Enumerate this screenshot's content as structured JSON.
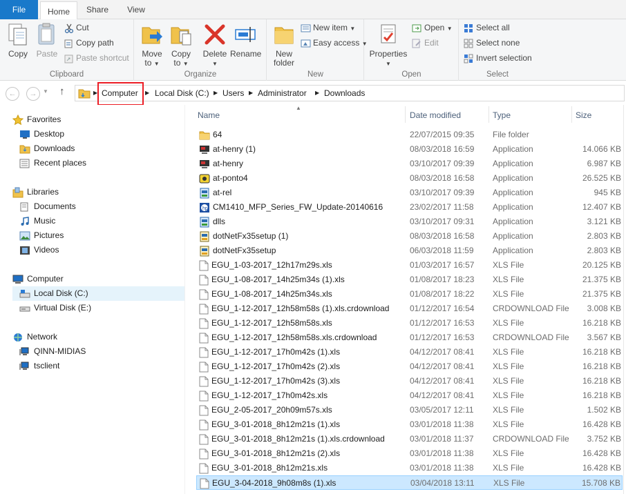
{
  "tabs": [
    {
      "label": "File"
    },
    {
      "label": "Home"
    },
    {
      "label": "Share"
    },
    {
      "label": "View"
    }
  ],
  "ribbon": {
    "clipboard": {
      "label": "Clipboard",
      "copy": "Copy",
      "paste": "Paste",
      "cut": "Cut",
      "copy_path": "Copy path",
      "paste_shortcut": "Paste shortcut"
    },
    "organize": {
      "label": "Organize",
      "move_to": "Move",
      "move_to2": "to",
      "copy_to": "Copy",
      "copy_to2": "to",
      "delete": "Delete",
      "rename": "Rename"
    },
    "new": {
      "label": "New",
      "new_folder": "New",
      "new_folder2": "folder",
      "new_item": "New item",
      "easy_access": "Easy access"
    },
    "open": {
      "label": "Open",
      "properties": "Properties",
      "open": "Open",
      "edit": "Edit"
    },
    "select": {
      "label": "Select",
      "select_all": "Select all",
      "select_none": "Select none",
      "invert": "Invert selection"
    }
  },
  "address": {
    "crumbs": [
      "Computer",
      "Local Disk (C:)",
      "Users",
      "Administrator",
      "Downloads"
    ]
  },
  "nav": {
    "favorites": "Favorites",
    "desktop": "Desktop",
    "downloads": "Downloads",
    "recent": "Recent places",
    "libraries": "Libraries",
    "documents": "Documents",
    "music": "Music",
    "pictures": "Pictures",
    "videos": "Videos",
    "computer": "Computer",
    "local_disk": "Local Disk (C:)",
    "virtual_disk": "Virtual Disk (E:)",
    "network": "Network",
    "qinn": "QINN-MIDIAS",
    "tsclient": "tsclient"
  },
  "columns": {
    "name": "Name",
    "date": "Date modified",
    "type": "Type",
    "size": "Size"
  },
  "files": [
    {
      "name": "64",
      "date": "22/07/2015 09:35",
      "type": "File folder",
      "size": "",
      "icon": "folder"
    },
    {
      "name": "at-henry (1)",
      "date": "08/03/2018 16:59",
      "type": "Application",
      "size": "14.066 KB",
      "icon": "app-dark"
    },
    {
      "name": "at-henry",
      "date": "03/10/2017 09:39",
      "type": "Application",
      "size": "6.987 KB",
      "icon": "app-dark"
    },
    {
      "name": "at-ponto4",
      "date": "08/03/2018 16:58",
      "type": "Application",
      "size": "26.525 KB",
      "icon": "app-yellow"
    },
    {
      "name": "at-rel",
      "date": "03/10/2017 09:39",
      "type": "Application",
      "size": "945 KB",
      "icon": "app-setup"
    },
    {
      "name": "CM1410_MFP_Series_FW_Update-20140616",
      "date": "23/02/2017 11:58",
      "type": "Application",
      "size": "12.407 KB",
      "icon": "app-hp"
    },
    {
      "name": "dlls",
      "date": "03/10/2017 09:31",
      "type": "Application",
      "size": "3.121 KB",
      "icon": "app-setup"
    },
    {
      "name": "dotNetFx35setup (1)",
      "date": "08/03/2018 16:58",
      "type": "Application",
      "size": "2.803 KB",
      "icon": "app-setup2"
    },
    {
      "name": "dotNetFx35setup",
      "date": "06/03/2018 11:59",
      "type": "Application",
      "size": "2.803 KB",
      "icon": "app-setup2"
    },
    {
      "name": "EGU_1-03-2017_12h17m29s.xls",
      "date": "01/03/2017 16:57",
      "type": "XLS File",
      "size": "20.125 KB",
      "icon": "doc"
    },
    {
      "name": "EGU_1-08-2017_14h25m34s (1).xls",
      "date": "01/08/2017 18:23",
      "type": "XLS File",
      "size": "21.375 KB",
      "icon": "doc"
    },
    {
      "name": "EGU_1-08-2017_14h25m34s.xls",
      "date": "01/08/2017 18:22",
      "type": "XLS File",
      "size": "21.375 KB",
      "icon": "doc"
    },
    {
      "name": "EGU_1-12-2017_12h58m58s (1).xls.crdownload",
      "date": "01/12/2017 16:54",
      "type": "CRDOWNLOAD File",
      "size": "3.008 KB",
      "icon": "doc"
    },
    {
      "name": "EGU_1-12-2017_12h58m58s.xls",
      "date": "01/12/2017 16:53",
      "type": "XLS File",
      "size": "16.218 KB",
      "icon": "doc"
    },
    {
      "name": "EGU_1-12-2017_12h58m58s.xls.crdownload",
      "date": "01/12/2017 16:53",
      "type": "CRDOWNLOAD File",
      "size": "3.567 KB",
      "icon": "doc"
    },
    {
      "name": "EGU_1-12-2017_17h0m42s (1).xls",
      "date": "04/12/2017 08:41",
      "type": "XLS File",
      "size": "16.218 KB",
      "icon": "doc"
    },
    {
      "name": "EGU_1-12-2017_17h0m42s (2).xls",
      "date": "04/12/2017 08:41",
      "type": "XLS File",
      "size": "16.218 KB",
      "icon": "doc"
    },
    {
      "name": "EGU_1-12-2017_17h0m42s (3).xls",
      "date": "04/12/2017 08:41",
      "type": "XLS File",
      "size": "16.218 KB",
      "icon": "doc"
    },
    {
      "name": "EGU_1-12-2017_17h0m42s.xls",
      "date": "04/12/2017 08:41",
      "type": "XLS File",
      "size": "16.218 KB",
      "icon": "doc"
    },
    {
      "name": "EGU_2-05-2017_20h09m57s.xls",
      "date": "03/05/2017 12:11",
      "type": "XLS File",
      "size": "1.502 KB",
      "icon": "doc"
    },
    {
      "name": "EGU_3-01-2018_8h12m21s (1).xls",
      "date": "03/01/2018 11:38",
      "type": "XLS File",
      "size": "16.428 KB",
      "icon": "doc"
    },
    {
      "name": "EGU_3-01-2018_8h12m21s (1).xls.crdownload",
      "date": "03/01/2018 11:37",
      "type": "CRDOWNLOAD File",
      "size": "3.752 KB",
      "icon": "doc"
    },
    {
      "name": "EGU_3-01-2018_8h12m21s (2).xls",
      "date": "03/01/2018 11:38",
      "type": "XLS File",
      "size": "16.428 KB",
      "icon": "doc"
    },
    {
      "name": "EGU_3-01-2018_8h12m21s.xls",
      "date": "03/01/2018 11:38",
      "type": "XLS File",
      "size": "16.428 KB",
      "icon": "doc"
    },
    {
      "name": "EGU_3-04-2018_9h08m8s (1).xls",
      "date": "03/04/2018 13:11",
      "type": "XLS File",
      "size": "15.708 KB",
      "icon": "doc",
      "selected": true
    }
  ],
  "colors": {
    "file_tab": "#1979ca",
    "selection": "#cce8ff",
    "annotation": "#ec1c24"
  }
}
